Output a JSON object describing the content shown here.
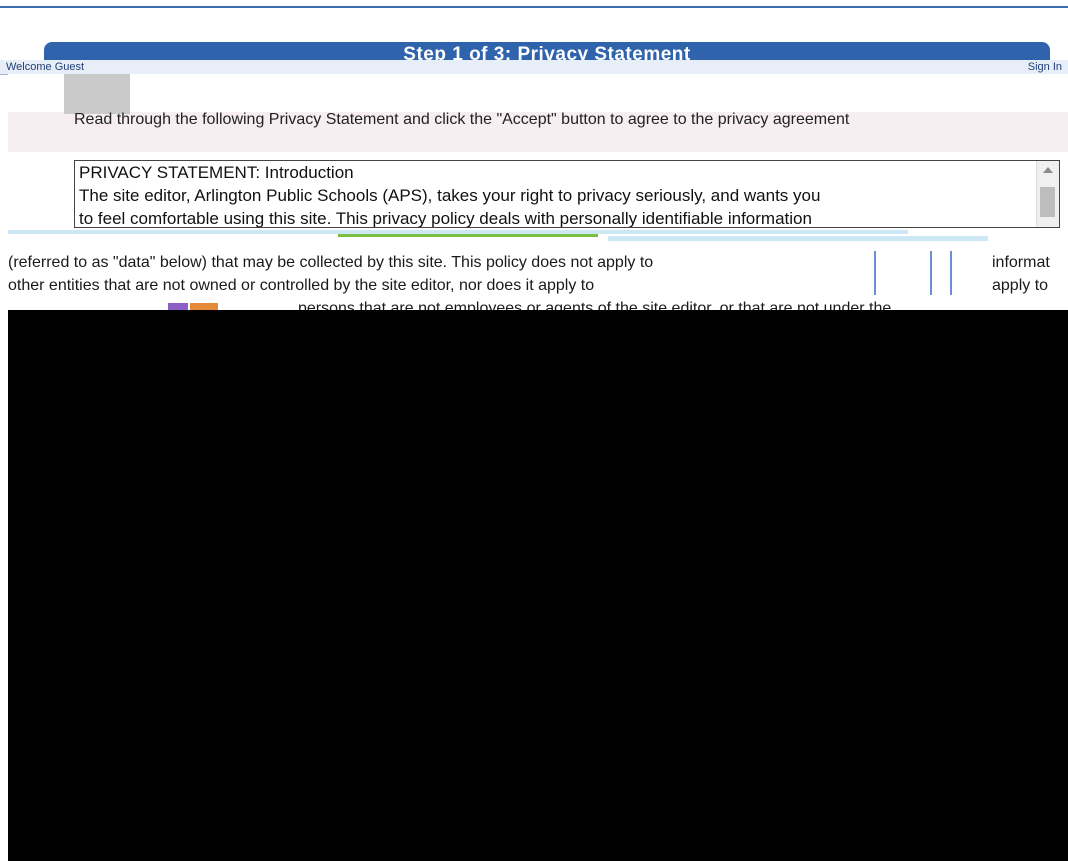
{
  "step_title": "Step 1 of 3: Privacy Statement",
  "status": {
    "left": "Welcome Guest",
    "right": "Sign In"
  },
  "instruction": "Read through the following Privacy Statement and click the \"Accept\" button to agree to the privacy agreement",
  "privacy": {
    "heading": "PRIVACY STATEMENT: Introduction",
    "line1": "The site editor, Arlington Public Schools (APS), takes your right to privacy seriously, and wants you",
    "line2": "to feel comfortable using this site. This privacy policy deals with personally identifiable information",
    "line3": "(referred to as \"data\" below) that may be collected by this site. This policy does not apply to",
    "line4": "other entities that are not owned or controlled by the site editor, nor does it apply to",
    "line5": "persons that are not employees or agents of the site editor, or that are not under the"
  },
  "overflow": {
    "right1": "informat",
    "right2": "apply to"
  },
  "colors": {
    "header": "#2f64ad",
    "accent": "#3b6db3"
  },
  "icons": {
    "scroll_up": "scroll-up-arrow-icon"
  }
}
